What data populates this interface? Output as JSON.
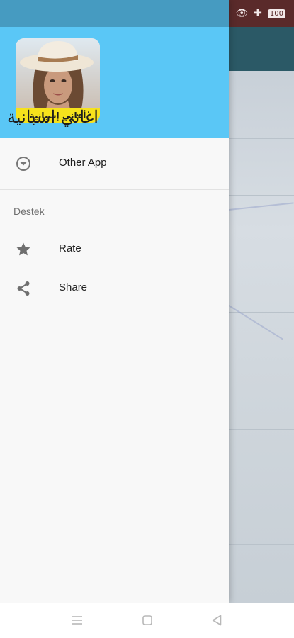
{
  "drawer": {
    "app_name": "اغاني اسبانية",
    "icon_caption": "أغاني إسبانية",
    "menu": {
      "other_app": {
        "label": "Other App",
        "icon": "chevron-down-circle-icon"
      }
    },
    "section": {
      "title": "Destek",
      "items": [
        {
          "label": "Rate",
          "icon": "star-icon"
        },
        {
          "label": "Share",
          "icon": "share-icon"
        }
      ]
    }
  },
  "status_bar": {
    "battery": "100"
  },
  "colors": {
    "header": "#5ac7f6",
    "drawer_status": "#469bc1",
    "icon_caption_bg": "#f6e21c",
    "app_status": "#5a2a2a",
    "app_toolbar": "#2b5966"
  },
  "navbar": {
    "icons": [
      "menu-icon",
      "home-square-icon",
      "back-triangle-icon"
    ]
  }
}
